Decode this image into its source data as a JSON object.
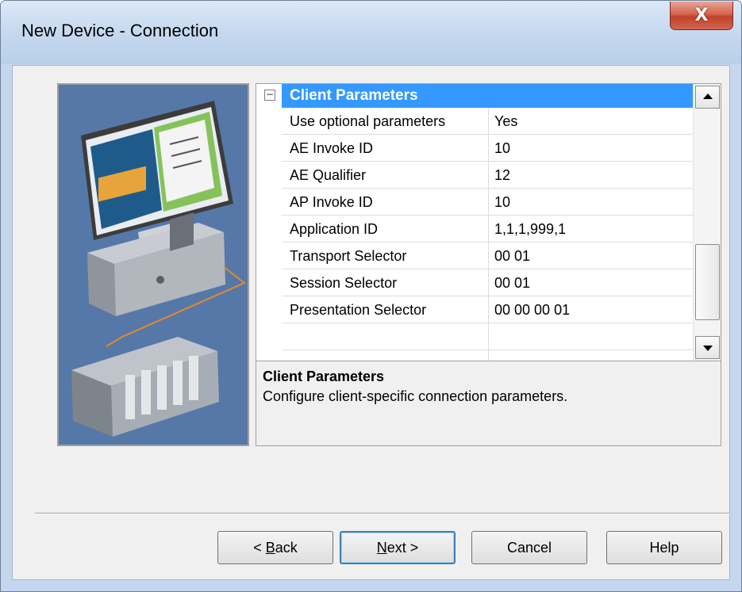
{
  "window": {
    "title": "New Device - Connection",
    "close_glyph": "X"
  },
  "property_grid": {
    "category": {
      "toggle": "−",
      "label": "Client Parameters"
    },
    "rows": [
      {
        "name": "Use optional parameters",
        "value": "Yes"
      },
      {
        "name": "AE Invoke ID",
        "value": "10"
      },
      {
        "name": "AE Qualifier",
        "value": "12"
      },
      {
        "name": "AP Invoke ID",
        "value": "10"
      },
      {
        "name": "Application ID",
        "value": "1,1,1,999,1"
      },
      {
        "name": "Transport Selector",
        "value": "00 01"
      },
      {
        "name": "Session Selector",
        "value": "00 01"
      },
      {
        "name": "Presentation Selector",
        "value": "00 00 00 01"
      },
      {
        "name": "",
        "value": ""
      }
    ]
  },
  "description": {
    "title": "Client Parameters",
    "text": "Configure client-specific connection parameters."
  },
  "buttons": {
    "back": {
      "prefix": "< ",
      "accel": "B",
      "rest": "ack"
    },
    "next": {
      "accel": "N",
      "rest": "ext >"
    },
    "cancel": "Cancel",
    "help": "Help"
  },
  "colors": {
    "selection": "#3399ff",
    "illustration_bg": "#5678a8",
    "close_button": "#c14129"
  },
  "icons": {
    "close": "close-icon",
    "collapse": "collapse-icon",
    "scroll_up": "arrow-up-icon",
    "scroll_down": "arrow-down-icon",
    "illustration": "computer-plc-illustration"
  }
}
